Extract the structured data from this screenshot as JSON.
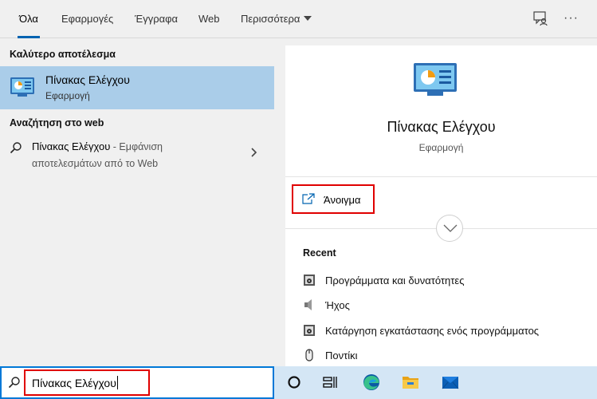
{
  "tabs": {
    "all": "Όλα",
    "apps": "Εφαρμογές",
    "documents": "Έγγραφα",
    "web": "Web",
    "more": "Περισσότερα"
  },
  "left": {
    "best_match_label": "Καλύτερο αποτέλεσμα",
    "best_match": {
      "name": "Πίνακας Ελέγχου",
      "type": "Εφαρμογή",
      "icon": "control-panel-icon"
    },
    "web_label": "Αναζήτηση στο web",
    "web_result": {
      "query": "Πίνακας Ελέγχου",
      "hint": " - Εμφάνιση",
      "hint_line2": "αποτελεσμάτων από το Web"
    }
  },
  "right": {
    "app_name": "Πίνακας Ελέγχου",
    "app_type": "Εφαρμογή",
    "open_label": "Άνοιγμα",
    "recent_label": "Recent",
    "recent_items": [
      {
        "label": "Προγράμματα και δυνατότητες",
        "icon": "programs-icon"
      },
      {
        "label": "Ήχος",
        "icon": "speaker-icon"
      },
      {
        "label": "Κατάργηση εγκατάστασης ενός προγράμματος",
        "icon": "programs-icon"
      },
      {
        "label": "Ποντίκι",
        "icon": "mouse-icon"
      }
    ]
  },
  "search": {
    "value": "Πίνακας Ελέγχου"
  },
  "colors": {
    "accent": "#0078d7",
    "selection": "#aacde9",
    "highlight_box": "#e00000",
    "taskbar": "#d4e6f5"
  }
}
